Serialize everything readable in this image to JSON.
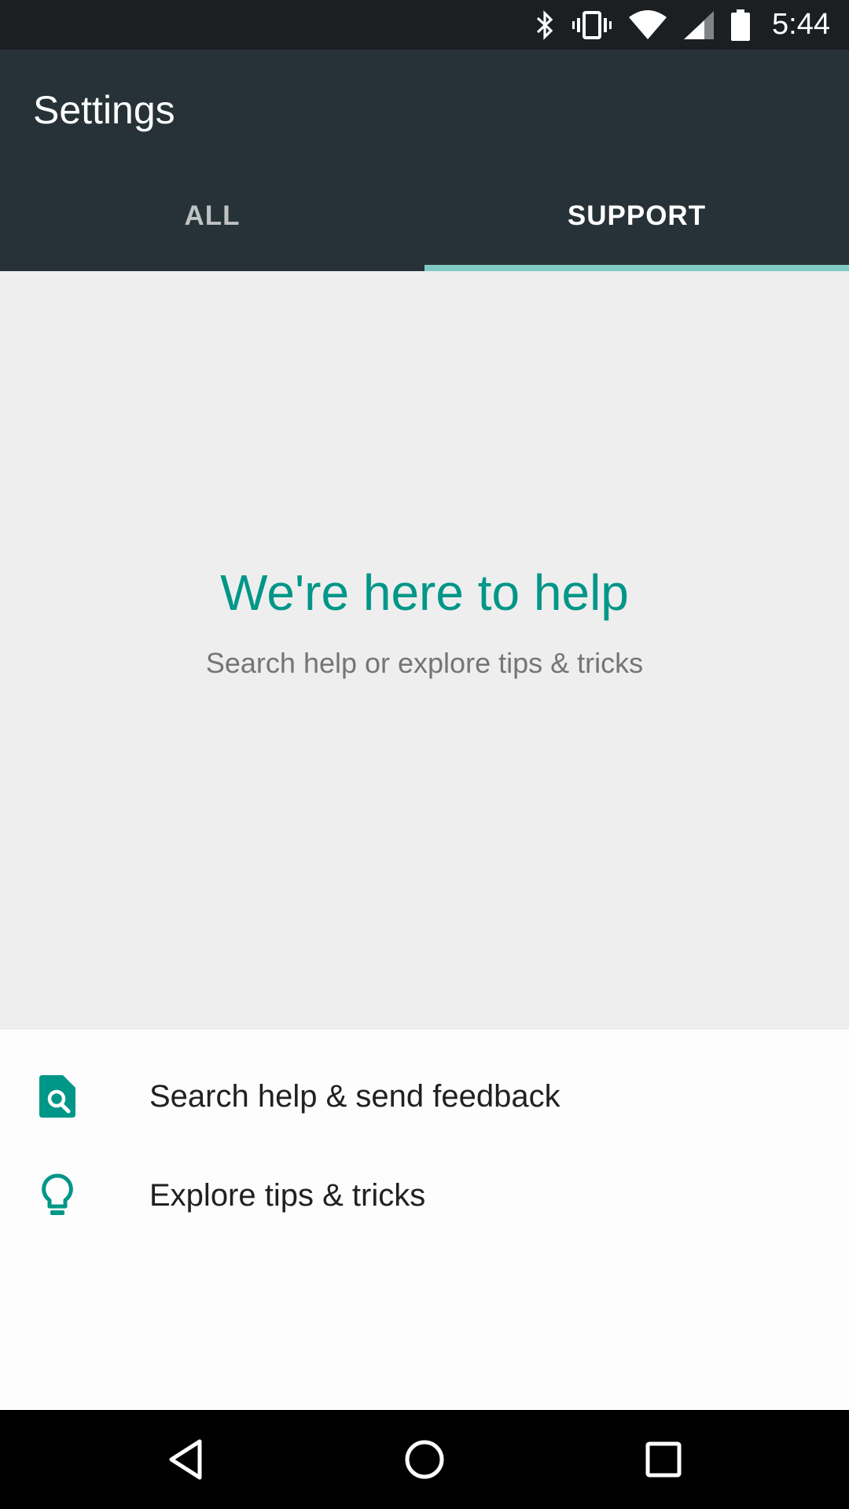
{
  "status_bar": {
    "time": "5:44",
    "icons": [
      "bluetooth-icon",
      "vibrate-icon",
      "wifi-icon",
      "signal-icon",
      "battery-icon"
    ]
  },
  "app_bar": {
    "title": "Settings",
    "tabs": [
      {
        "label": "ALL",
        "active": false
      },
      {
        "label": "SUPPORT",
        "active": true
      }
    ]
  },
  "hero": {
    "title": "We're here to help",
    "subtitle": "Search help or explore tips & tricks"
  },
  "actions": [
    {
      "label": "Search help & send feedback",
      "icon": "search-help-icon"
    },
    {
      "label": "Explore tips & tricks",
      "icon": "lightbulb-icon"
    }
  ],
  "nav_bar": {
    "buttons": [
      "back-icon",
      "home-icon",
      "recents-icon"
    ]
  },
  "colors": {
    "status_bar": "#1b1f22",
    "app_bar": "#263238",
    "tab_indicator": "#80cbc4",
    "accent": "#009688",
    "hero_bg": "#eeeeee"
  }
}
